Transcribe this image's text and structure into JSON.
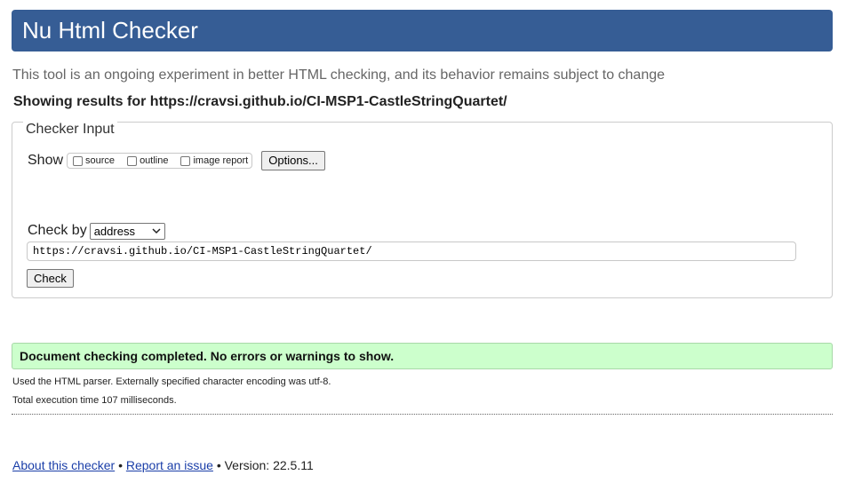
{
  "header": {
    "title": "Nu Html Checker",
    "background_color": "#365d95"
  },
  "intro_text": "This tool is an ongoing experiment in better HTML checking, and its behavior remains subject to change",
  "results_for": "Showing results for https://cravsi.github.io/CI-MSP1-CastleStringQuartet/",
  "checker_input": {
    "legend": "Checker Input",
    "show_label": "Show",
    "checkboxes": [
      {
        "label": "source",
        "checked": false
      },
      {
        "label": "outline",
        "checked": false
      },
      {
        "label": "image report",
        "checked": false
      }
    ],
    "options_button": "Options...",
    "check_by_label": "Check by",
    "check_by_selected": "address",
    "url_value": "https://cravsi.github.io/CI-MSP1-CastleStringQuartet/",
    "check_button": "Check"
  },
  "result": {
    "message": "Document checking completed. No errors or warnings to show.",
    "background_color": "#ccffcc"
  },
  "details": {
    "parser_info": "Used the HTML parser. Externally specified character encoding was utf-8.",
    "execution_time": "Total execution time 107 milliseconds."
  },
  "footer": {
    "about_link": "About this checker",
    "separator": "•",
    "report_link": "Report an issue",
    "version_text": "Version: 22.5.11"
  }
}
